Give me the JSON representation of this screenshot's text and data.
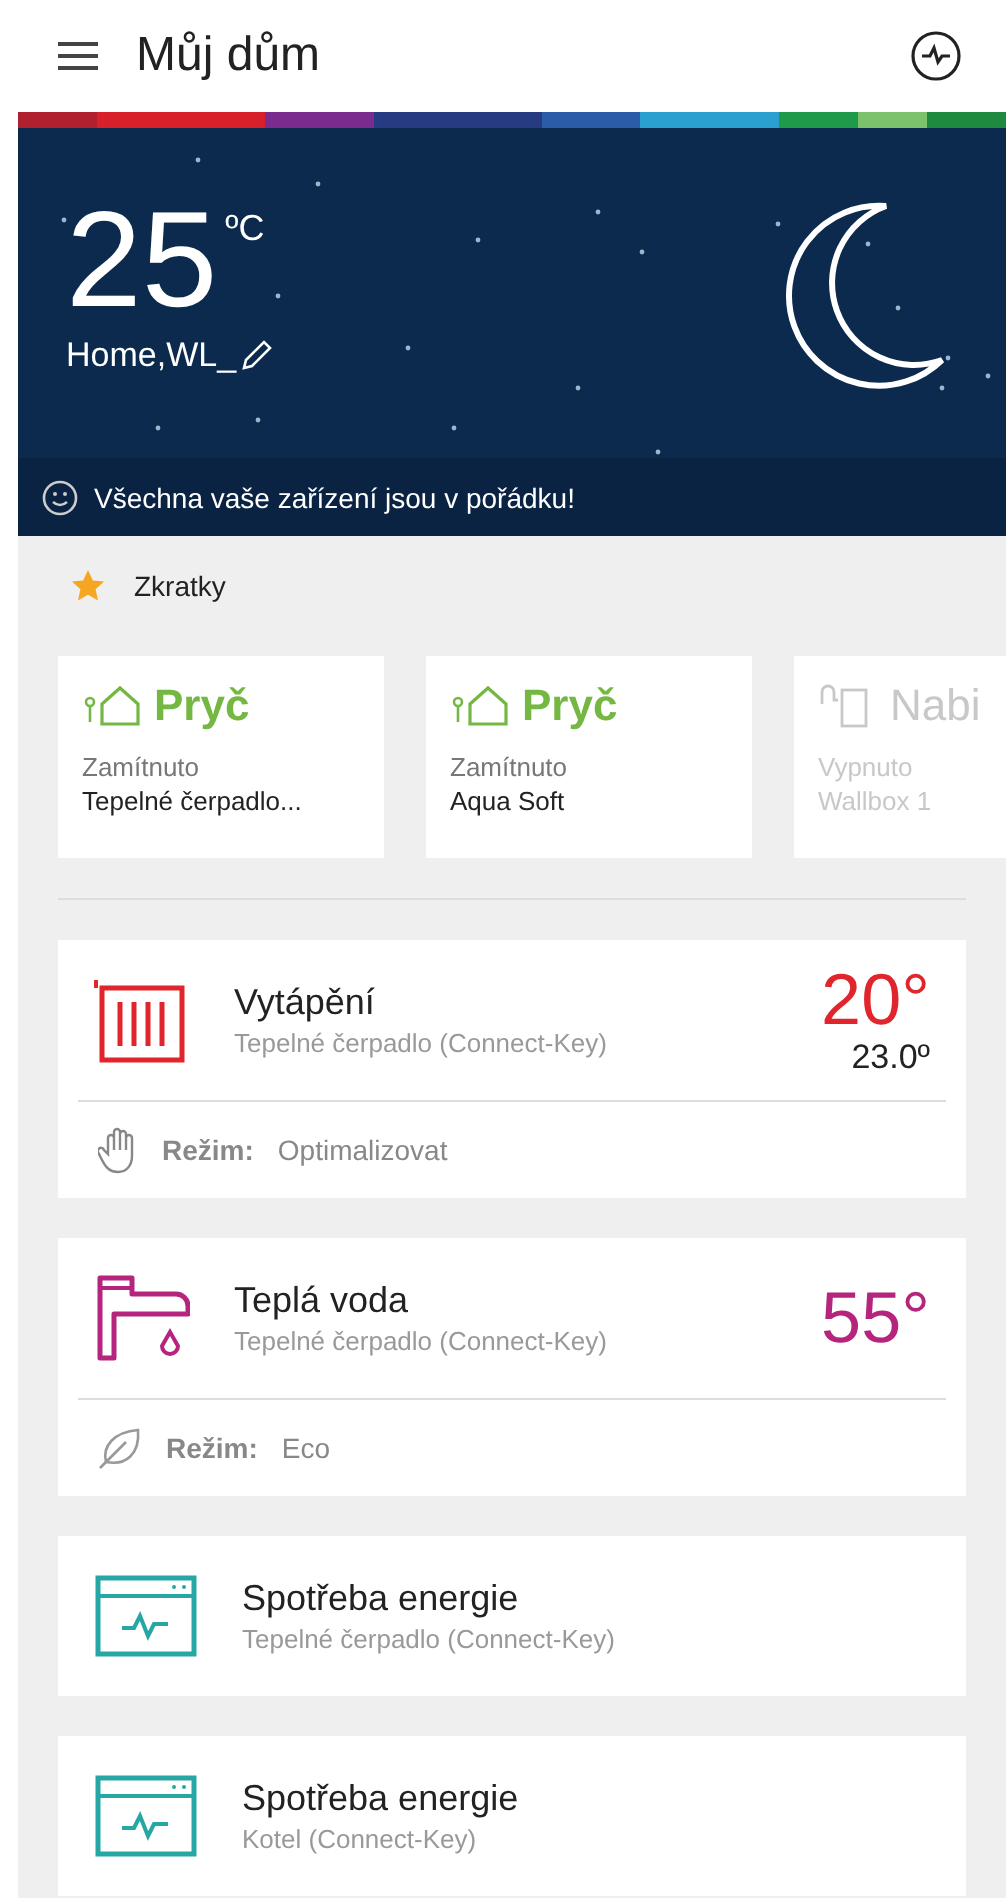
{
  "header": {
    "title": "Můj dům"
  },
  "weather": {
    "temperature": "25",
    "unit": "ºC",
    "location": "Home,WL_",
    "status": "Všechna vaše zařízení jsou v pořádku!"
  },
  "shortcuts": {
    "title": "Zkratky",
    "items": [
      {
        "kind": "away",
        "title": "Pryč",
        "state": "Zamítnuto",
        "device": "Tepelné čerpadlo...",
        "disabled": false
      },
      {
        "kind": "away",
        "title": "Pryč",
        "state": "Zamítnuto",
        "device": "Aqua Soft",
        "disabled": false
      },
      {
        "kind": "charge",
        "title": "Nabi",
        "state": "Vypnuto",
        "device": "Wallbox 1",
        "disabled": true
      }
    ]
  },
  "devices": [
    {
      "kind": "heating",
      "color": "#e0262c",
      "title": "Vytápění",
      "subtitle": "Tepelné čerpadlo (Connect-Key)",
      "setpoint": "20°",
      "current": "23.0º",
      "mode": {
        "kind": "manual",
        "label": "Režim:",
        "value": "Optimalizovat"
      }
    },
    {
      "kind": "water",
      "color": "#b5257e",
      "title": "Teplá voda",
      "subtitle": "Tepelné čerpadlo (Connect-Key)",
      "setpoint": "55°",
      "mode": {
        "kind": "eco",
        "label": "Režim:",
        "value": "Eco"
      }
    },
    {
      "kind": "energy",
      "color": "#26a7a3",
      "title": "Spotřeba energie",
      "subtitle": "Tepelné čerpadlo (Connect-Key)"
    },
    {
      "kind": "energy",
      "color": "#26a7a3",
      "title": "Spotřeba energie",
      "subtitle": "Kotel (Connect-Key)"
    }
  ]
}
